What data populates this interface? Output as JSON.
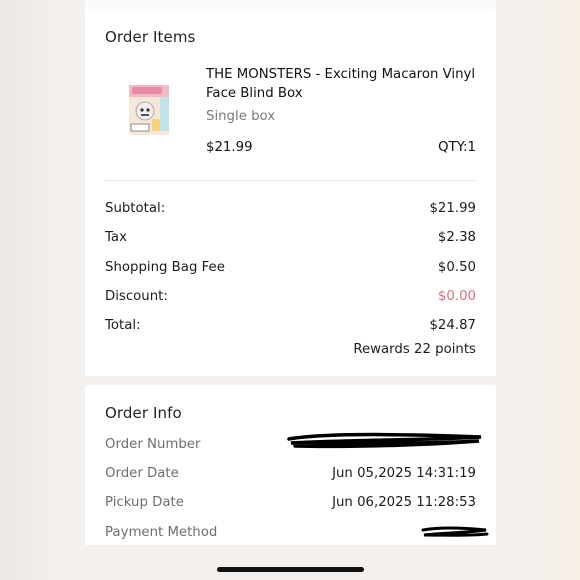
{
  "order_items": {
    "title": "Order Items",
    "product": {
      "name": "THE MONSTERS - Exciting Macaron Vinyl Face Blind Box",
      "variant": "Single box",
      "price": "$21.99",
      "qty": "QTY:1",
      "image_icon": "product-blind-box-image"
    }
  },
  "summary": {
    "rows": [
      {
        "label": "Subtotal:",
        "value": "$21.99"
      },
      {
        "label": "Tax",
        "value": "$2.38"
      },
      {
        "label": "Shopping Bag Fee",
        "value": "$0.50"
      },
      {
        "label": "Discount:",
        "value": "$0.00"
      },
      {
        "label": "Total:",
        "value": "$24.87"
      }
    ],
    "rewards": "Rewards 22 points",
    "discount_color": "#d6707e"
  },
  "order_info": {
    "title": "Order Info",
    "rows": [
      {
        "label": "Order Number",
        "value": ""
      },
      {
        "label": "Order Date",
        "value": "Jun 05,2025 14:31:19"
      },
      {
        "label": "Pickup Date",
        "value": "Jun 06,2025 11:28:53"
      },
      {
        "label": "Payment Method",
        "value": ""
      }
    ]
  }
}
